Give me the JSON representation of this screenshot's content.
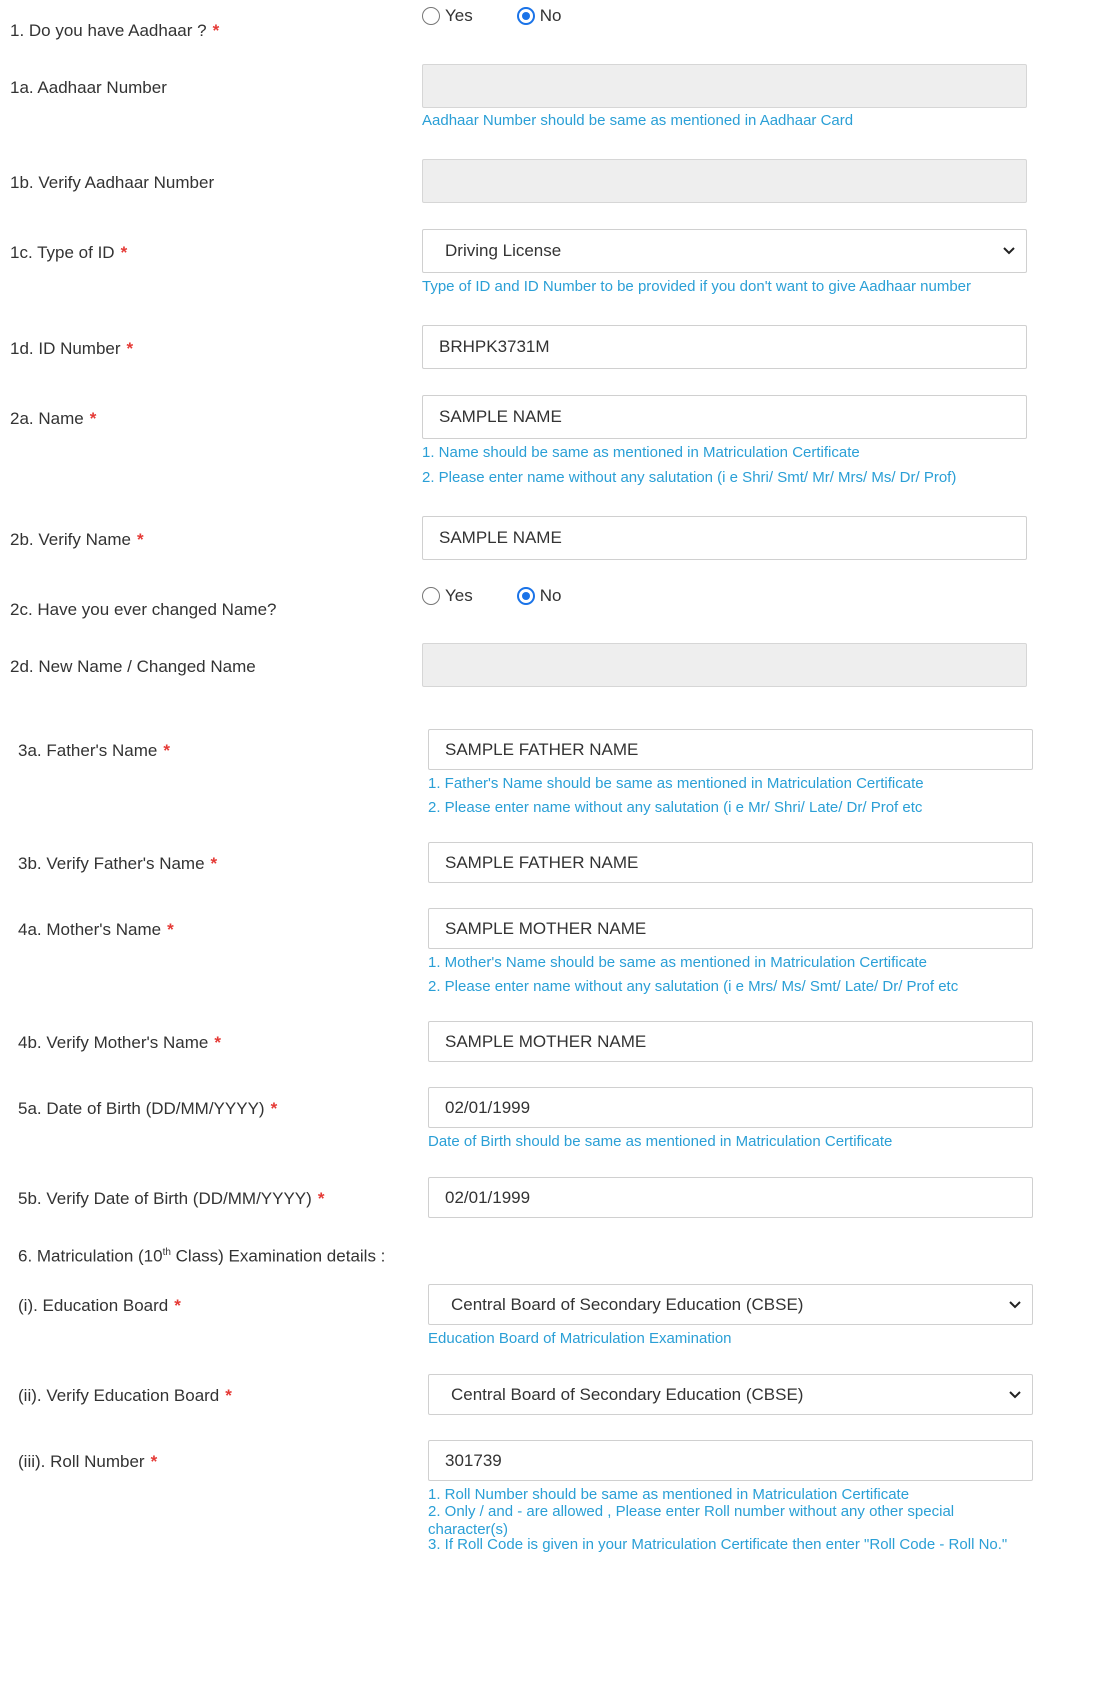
{
  "q1": {
    "label": "1. Do you have Aadhaar ?",
    "options": [
      "Yes",
      "No"
    ],
    "selected": "No"
  },
  "q1a": {
    "label": "1a. Aadhaar Number",
    "value": "",
    "hint": "Aadhaar Number should be same as mentioned in Aadhaar Card"
  },
  "q1b": {
    "label": "1b. Verify Aadhaar Number",
    "value": ""
  },
  "q1c": {
    "label": "1c. Type of ID",
    "value": "Driving License",
    "hint": "Type of ID and ID Number to be provided if you don't want to give Aadhaar number"
  },
  "q1d": {
    "label": "1d. ID Number",
    "value": "BRHPK3731M"
  },
  "q2a": {
    "label": "2a. Name",
    "value": "SAMPLE NAME",
    "hints": [
      "1. Name should be same as mentioned in Matriculation Certificate",
      "2. Please enter name without any salutation (i e Shri/ Smt/ Mr/ Mrs/ Ms/ Dr/ Prof)"
    ]
  },
  "q2b": {
    "label": "2b. Verify Name",
    "value": "SAMPLE NAME"
  },
  "q2c": {
    "label": "2c. Have you ever changed Name?",
    "options": [
      "Yes",
      "No"
    ],
    "selected": "No"
  },
  "q2d": {
    "label": "2d. New Name / Changed Name",
    "value": ""
  },
  "q3a": {
    "label": "3a. Father's Name",
    "value": "SAMPLE FATHER NAME",
    "hints": [
      "1. Father's Name should be same as mentioned in Matriculation Certificate",
      "2. Please enter name without any salutation (i e Mr/ Shri/ Late/ Dr/ Prof etc"
    ]
  },
  "q3b": {
    "label": "3b. Verify Father's Name",
    "value": "SAMPLE FATHER NAME"
  },
  "q4a": {
    "label": "4a. Mother's Name",
    "value": "SAMPLE MOTHER NAME",
    "hints": [
      "1. Mother's Name should be same as mentioned in Matriculation Certificate",
      "2. Please enter name without any salutation (i e Mrs/ Ms/ Smt/ Late/ Dr/ Prof etc"
    ]
  },
  "q4b": {
    "label": "4b. Verify Mother's Name",
    "value": "SAMPLE MOTHER NAME"
  },
  "q5a": {
    "label": "5a. Date of Birth (DD/MM/YYYY)",
    "value": "02/01/1999",
    "hint": "Date of Birth should be same as mentioned in Matriculation Certificate"
  },
  "q5b": {
    "label": "5b. Verify Date of Birth (DD/MM/YYYY)",
    "value": "02/01/1999"
  },
  "q6": {
    "label_pre": "6. Matriculation (10",
    "label_sup": "th",
    "label_post": " Class) Examination details :"
  },
  "q6i": {
    "label": "(i). Education Board",
    "value": "Central Board of Secondary Education (CBSE)",
    "hint": "Education Board of Matriculation Examination"
  },
  "q6ii": {
    "label": "(ii). Verify Education Board",
    "value": "Central Board of Secondary Education (CBSE)"
  },
  "q6iii": {
    "label": "(iii). Roll Number",
    "value": "301739",
    "hints": [
      "1. Roll Number should be same as mentioned in Matriculation Certificate",
      "2. Only / and - are allowed , Please enter Roll number without any other special character(s)",
      "3. If Roll Code is given in your Matriculation Certificate then enter \"Roll Code - Roll No.\""
    ]
  },
  "required_marker": "*",
  "icons": {
    "select_arrow": "chevron-down-icon"
  },
  "colors": {
    "hint": "#2a9fd6",
    "required": "#e53935",
    "radio_selected": "#1a73e8",
    "disabled_field": "#eeeeee"
  }
}
